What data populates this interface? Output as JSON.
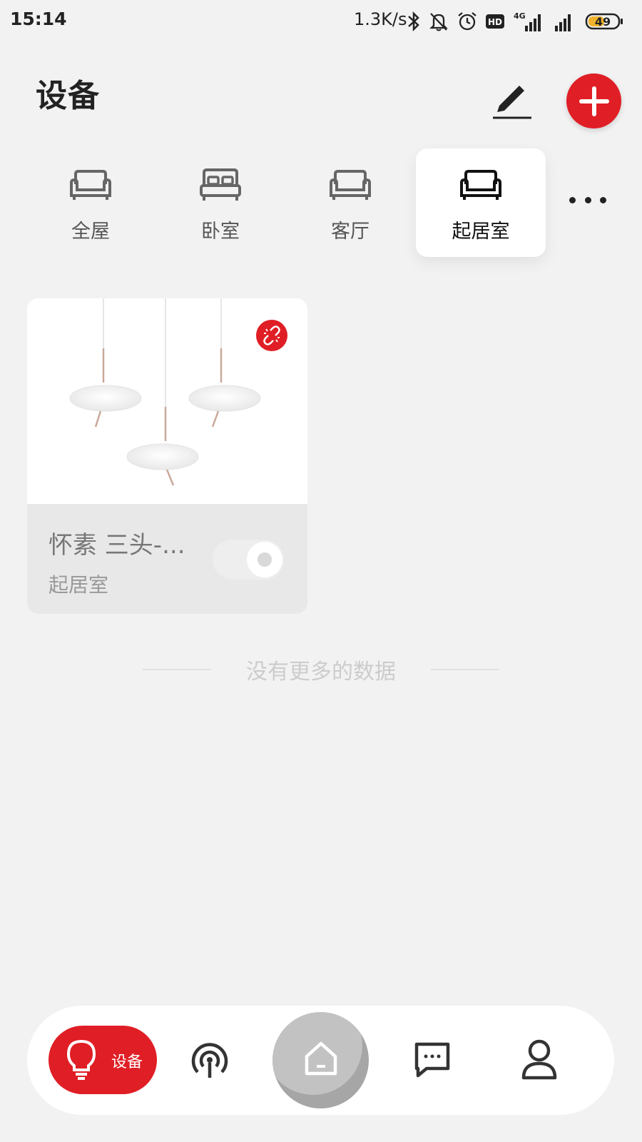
{
  "status_bar": {
    "time": "15:14",
    "network_speed": "1.3K/s",
    "hd_label": "HD",
    "network_type": "4G",
    "battery": "49",
    "icons": [
      "bluetooth-icon",
      "bell-muted-icon",
      "alarm-icon",
      "hd-icon",
      "signal-4g-icon",
      "signal-icon",
      "battery-icon"
    ]
  },
  "header": {
    "title": "设备",
    "edit_icon": "pencil-icon",
    "add_icon": "plus-icon"
  },
  "rooms": {
    "items": [
      {
        "label": "全屋",
        "icon": "sofa-icon"
      },
      {
        "label": "卧室",
        "icon": "bed-icon"
      },
      {
        "label": "客厅",
        "icon": "sofa-icon"
      },
      {
        "label": "起居室",
        "icon": "sofa-icon",
        "active": true
      }
    ],
    "more_icon": "more-dots-icon"
  },
  "devices": [
    {
      "name": "怀素 三头-...",
      "room": "起居室",
      "image": "pendant-lamp-three-heads",
      "status_icon": "unlink-icon",
      "switch_on": false
    }
  ],
  "list_end_text": "没有更多的数据",
  "bottom_nav": {
    "devices_label": "设备",
    "items": [
      "bulb-icon",
      "broadcast-icon",
      "home-icon",
      "message-icon",
      "user-icon"
    ]
  },
  "colors": {
    "accent": "#e01e25",
    "background": "#f2f2f2",
    "card_bottom": "#e8e8e9"
  }
}
